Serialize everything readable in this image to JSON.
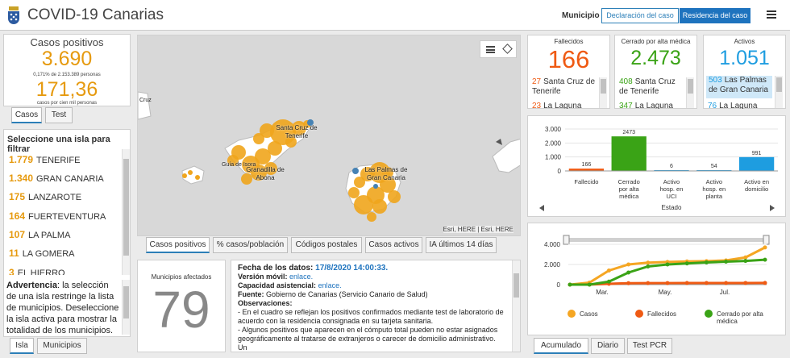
{
  "header": {
    "title": "COVID-19 Canarias",
    "toggle_label": "Municipio",
    "btn_declaracion": "Declaración del caso",
    "btn_residencia": "Residencia del caso"
  },
  "casos": {
    "title": "Casos positivos",
    "value": "3.690",
    "pct": "0,171% de 2.153.389 personas",
    "rate": "171,36",
    "rate_label": "casos por cien mil personas",
    "tabs": [
      "Casos",
      "Test"
    ]
  },
  "islands": {
    "heading": "Seleccione una isla para filtrar",
    "items": [
      {
        "count": "1.779",
        "name": "TENERIFE"
      },
      {
        "count": "1.340",
        "name": "GRAN CANARIA"
      },
      {
        "count": "175",
        "name": "LANZAROTE"
      },
      {
        "count": "164",
        "name": "FUERTEVENTURA"
      },
      {
        "count": "107",
        "name": "LA PALMA"
      },
      {
        "count": "11",
        "name": "LA GOMERA"
      },
      {
        "count": "3",
        "name": "EL HIERRO"
      }
    ],
    "warning_bold": "Advertencia",
    "warning_text": ": la selección de una isla restringe la lista de municipios. Deseleccione la isla activa para mostrar la totalidad de los municipios.",
    "tabs": [
      "Isla",
      "Municipios"
    ]
  },
  "map": {
    "labels": [
      "Santa Cruz de Tenerife",
      "Guía de Isora",
      "Granadilla de Abona",
      "Las Palmas de Gran Canaria",
      "Cruz"
    ],
    "attribution": "Esri, HERE | Esri, HERE",
    "tabs": [
      "Casos positivos",
      "% casos/población",
      "Códigos postales",
      "Casos activos",
      "IA últimos 14 días"
    ]
  },
  "municipios": {
    "title": "Municipios afectados",
    "value": "79"
  },
  "info": {
    "fecha_label": "Fecha de los datos:",
    "fecha_value": "17/8/2020 14:00:33.",
    "movil_label": "Versión móvil:",
    "movil_link": "enlace.",
    "capacidad_label": "Capacidad asistencial:",
    "capacidad_link": "enlace.",
    "fuente_label": "Fuente:",
    "fuente_value": "Gobierno de Canarias (Servicio Canario de Salud)",
    "obs_label": "Observaciones:",
    "obs1": "- En el cuadro se reflejan los positivos confirmados mediante test de laboratorio de acuerdo con la residencia consignada en su tarjeta sanitaria.",
    "obs2": "- Algunos positivos que aparecen en el cómputo total pueden no estar asignados geográficamente al tratarse de extranjeros o carecer de domicilio administrativo. Un"
  },
  "fallecidos": {
    "title": "Fallecidos",
    "value": "166",
    "rows": [
      {
        "count": "27",
        "name": "Santa Cruz de Tenerife"
      },
      {
        "count": "23",
        "name": "La Laguna"
      }
    ],
    "color": "#ef5a13"
  },
  "cerrado": {
    "title": "Cerrado por alta médica",
    "value": "2.473",
    "rows": [
      {
        "count": "408",
        "name": "Santa Cruz de Tenerife"
      },
      {
        "count": "347",
        "name": "La Laguna"
      }
    ],
    "color": "#3aa316"
  },
  "activos": {
    "title": "Activos",
    "value": "1.051",
    "rows": [
      {
        "count": "503",
        "name": "Las Palmas de Gran Canaria"
      },
      {
        "count": "76",
        "name": "La Laguna"
      }
    ],
    "color": "#1e9de0"
  },
  "chart_data": [
    {
      "type": "bar",
      "categories": [
        "Fallecido",
        "Cerrado por alta médica",
        "Activo hosp. en UCI",
        "Activo hosp. en planta",
        "Activo en domicilio"
      ],
      "values": [
        166,
        2473,
        6,
        54,
        991
      ],
      "colors": [
        "#ef5a13",
        "#3aa316",
        "#1e9de0",
        "#1e9de0",
        "#1e9de0"
      ],
      "xlabel": "Estado",
      "ylim": [
        0,
        3000
      ],
      "yticks": [
        "3.000",
        "2.000",
        "1.000",
        "0"
      ]
    },
    {
      "type": "line",
      "x_ticks": [
        "Mar.",
        "May.",
        "Jul."
      ],
      "ylim": [
        0,
        4000
      ],
      "yticks": [
        "4.000",
        "2.000",
        "0"
      ],
      "series": [
        {
          "name": "Casos",
          "color": "#f5a623",
          "values": [
            0,
            200,
            1400,
            2000,
            2180,
            2250,
            2300,
            2330,
            2400,
            2700,
            3690
          ]
        },
        {
          "name": "Fallecidos",
          "color": "#ef5a13",
          "values": [
            0,
            5,
            80,
            140,
            150,
            155,
            158,
            160,
            162,
            164,
            166
          ]
        },
        {
          "name": "Cerrado por alta médica",
          "color": "#3aa316",
          "values": [
            0,
            0,
            300,
            1200,
            1800,
            2000,
            2100,
            2200,
            2280,
            2350,
            2473
          ]
        }
      ]
    }
  ],
  "estado_tabs": [
    "Acumulado",
    "Diario",
    "Test PCR"
  ]
}
